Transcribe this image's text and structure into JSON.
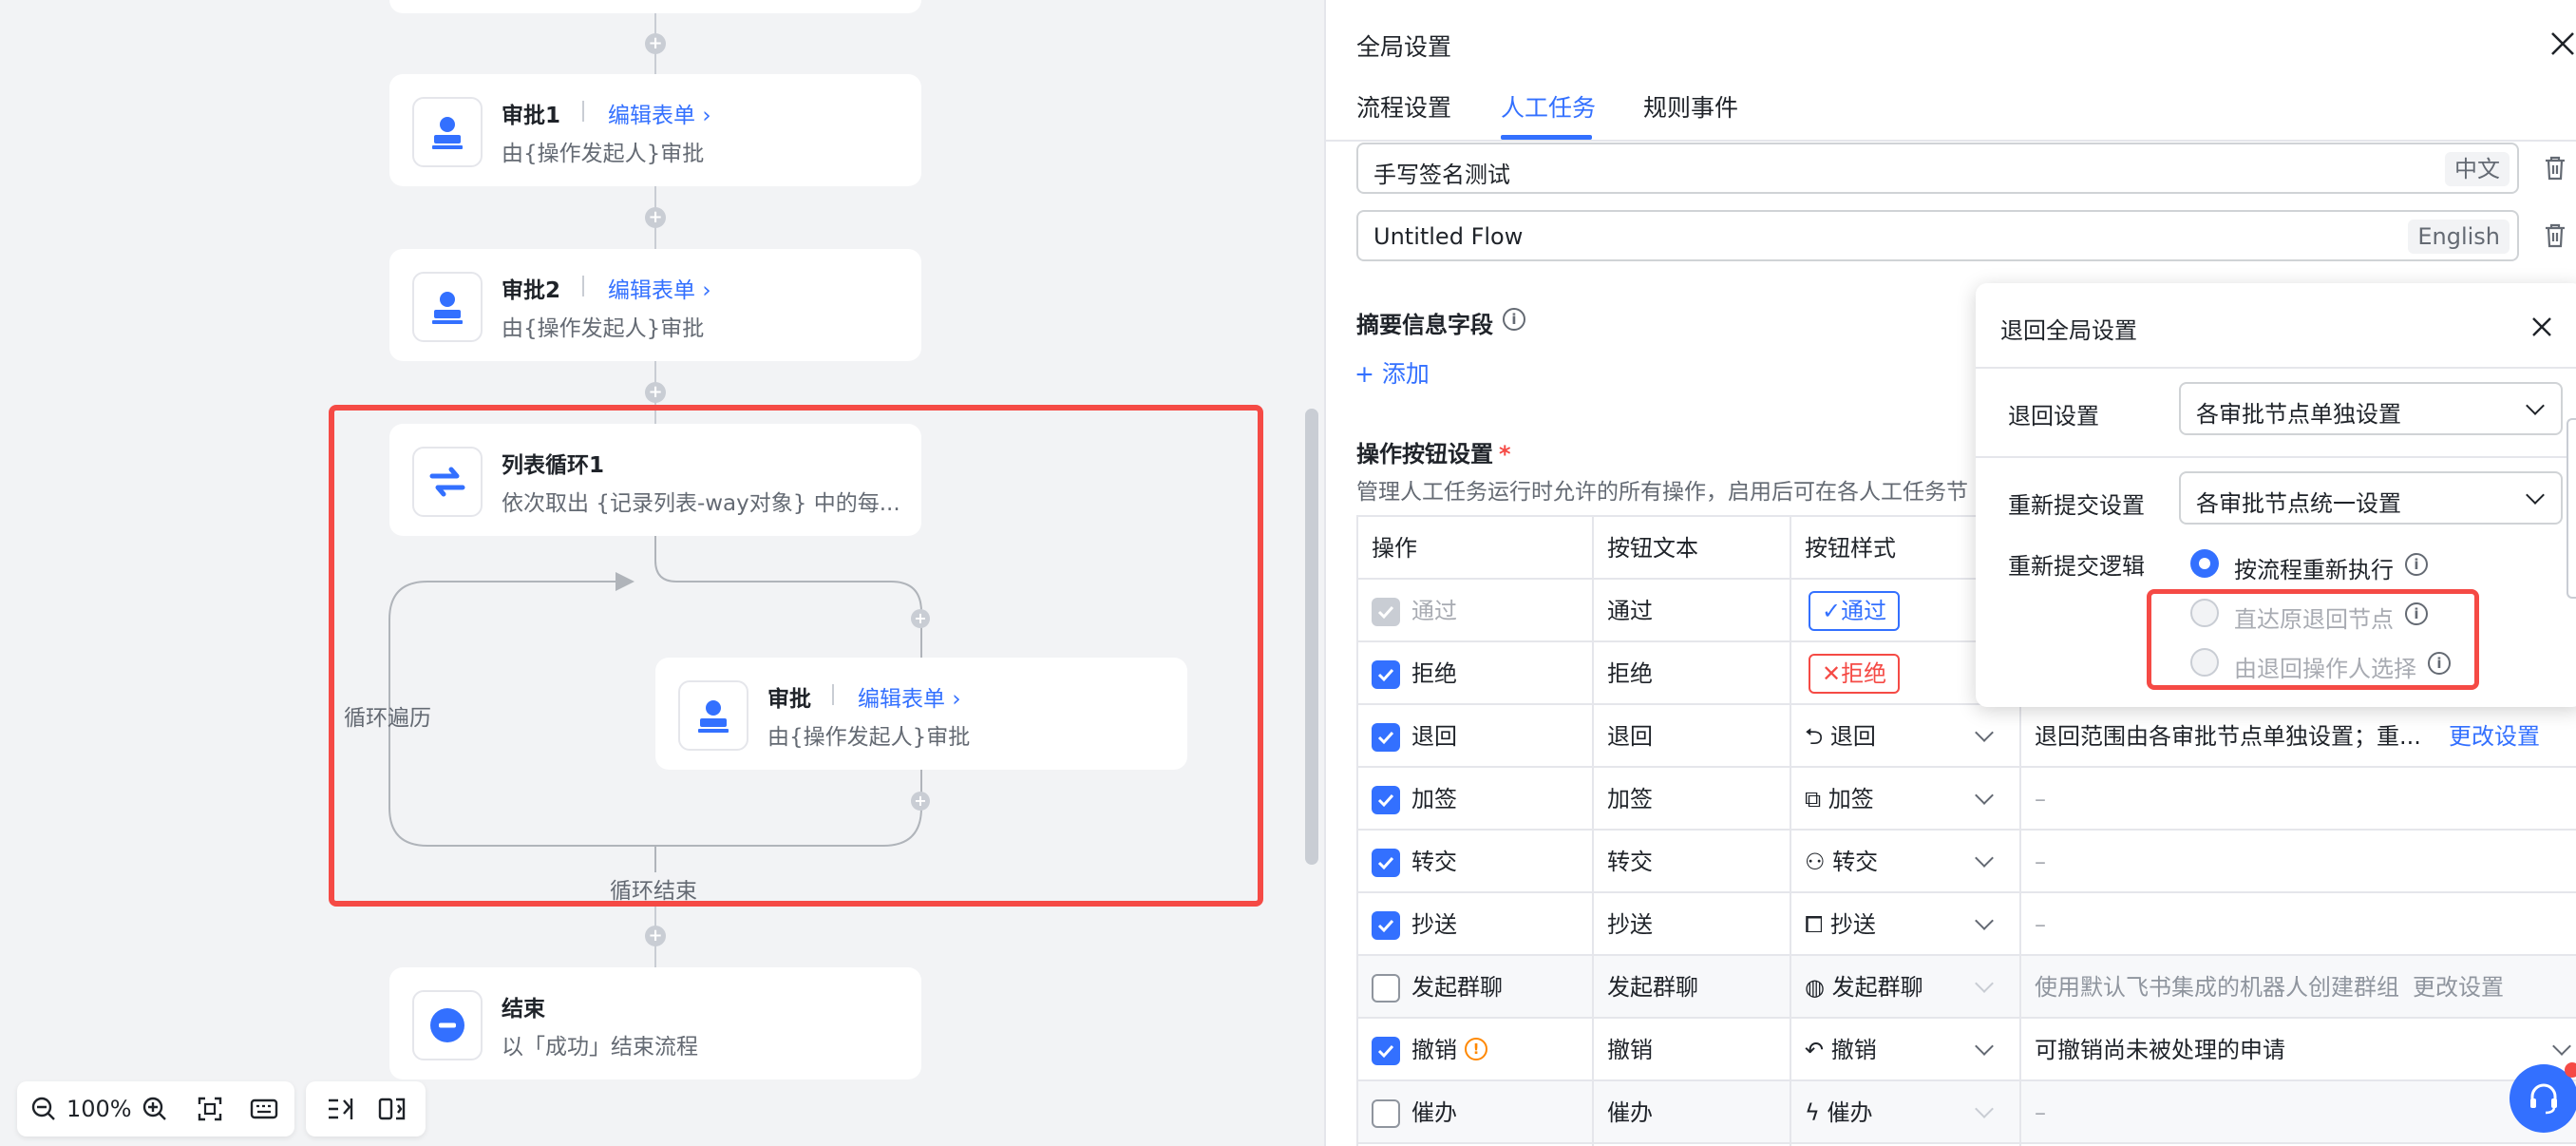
{
  "canvas": {
    "nodes": {
      "approval1": {
        "title": "审批1",
        "edit": "编辑表单",
        "desc": "由{操作发起人}审批"
      },
      "approval2": {
        "title": "审批2",
        "edit": "编辑表单",
        "desc": "由{操作发起人}审批"
      },
      "loop": {
        "title": "列表循环1",
        "desc": "依次取出 {记录列表-way对象} 中的每..."
      },
      "inner": {
        "title": "审批",
        "edit": "编辑表单",
        "desc": "由{操作发起人}审批"
      },
      "end": {
        "title": "结束",
        "desc": "以「成功」结束流程"
      }
    },
    "loop_traverse": "循环遍历",
    "loop_end": "循环结束",
    "zoom": "100%"
  },
  "panel": {
    "title": "全局设置",
    "tabs": [
      "流程设置",
      "人工任务",
      "规则事件"
    ],
    "name_zh": {
      "value": "手写签名测试",
      "lang": "中文"
    },
    "name_en": {
      "value": "Untitled Flow",
      "lang": "English"
    },
    "summary_title": "摘要信息字段",
    "add": "添加",
    "ops_title": "操作按钮设置",
    "required": "*",
    "ops_desc": "管理人工任务运行时允许的所有操作，启用后可在各人工任务节",
    "headers": [
      "操作",
      "按钮文本",
      "按钮样式"
    ],
    "rows": [
      {
        "op": "通过",
        "text": "通过",
        "style": "通过",
        "desc": "",
        "link": ""
      },
      {
        "op": "拒绝",
        "text": "拒绝",
        "style": "拒绝",
        "desc": "",
        "link": ""
      },
      {
        "op": "退回",
        "text": "退回",
        "style": "退回",
        "desc": "退回范围由各审批节点单独设置；重...",
        "link": "更改设置"
      },
      {
        "op": "加签",
        "text": "加签",
        "style": "加签",
        "desc": "–",
        "link": ""
      },
      {
        "op": "转交",
        "text": "转交",
        "style": "转交",
        "desc": "–",
        "link": ""
      },
      {
        "op": "抄送",
        "text": "抄送",
        "style": "抄送",
        "desc": "–",
        "link": ""
      },
      {
        "op": "发起群聊",
        "text": "发起群聊",
        "style": "发起群聊",
        "desc": "使用默认飞书集成的机器人创建群组",
        "link": "更改设置"
      },
      {
        "op": "撤销",
        "text": "撤销",
        "style": "撤销",
        "desc": "可撤销尚未被处理的申请",
        "link": ""
      },
      {
        "op": "催办",
        "text": "催办",
        "style": "催办",
        "desc": "–",
        "link": ""
      }
    ]
  },
  "popover": {
    "title": "退回全局设置",
    "return_label": "退回设置",
    "return_value": "各审批节点单独设置",
    "resubmit_label": "重新提交设置",
    "resubmit_value": "各审批节点统一设置",
    "logic_label": "重新提交逻辑",
    "options": [
      "按流程重新执行",
      "直达原退回节点",
      "由退回操作人选择"
    ]
  },
  "colors": {
    "accent": "#3370ff",
    "highlight": "#f54a45"
  }
}
